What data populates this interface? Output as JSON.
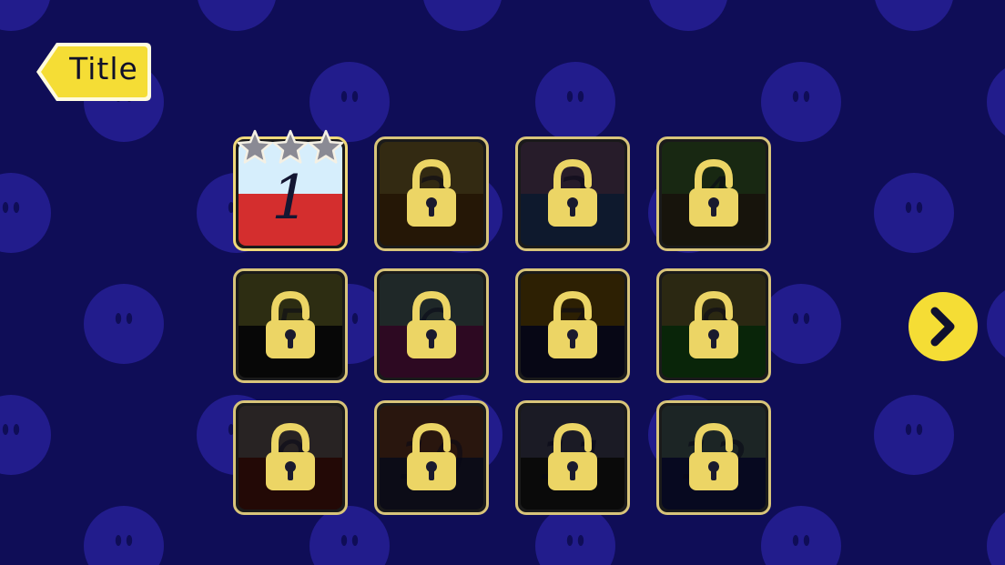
{
  "colors": {
    "background": "#0f0d57",
    "pattern_circle": "#221c8c",
    "accent_yellow": "#f5dd35",
    "tile_border": "#d8c47a",
    "lock_yellow": "#ecd565"
  },
  "header": {
    "title_button_label": "Title"
  },
  "levels": [
    {
      "number": "1",
      "locked": false,
      "stars_earned": 0,
      "stars_total": 3
    },
    {
      "number": "2",
      "locked": true,
      "top": "#423618",
      "bottom": "#301e08"
    },
    {
      "number": "3",
      "locked": true,
      "top": "#332436",
      "bottom": "#12203a"
    },
    {
      "number": "4",
      "locked": true,
      "top": "#1f3418",
      "bottom": "#1e1a10"
    },
    {
      "number": "5",
      "locked": true,
      "top": "#3a3a18",
      "bottom": "#090909"
    },
    {
      "number": "6",
      "locked": true,
      "top": "#283434",
      "bottom": "#3a0c2c"
    },
    {
      "number": "7",
      "locked": true,
      "top": "#3a2a05",
      "bottom": "#0a0a1c"
    },
    {
      "number": "8",
      "locked": true,
      "top": "#383418",
      "bottom": "#0c300c"
    },
    {
      "number": "9",
      "locked": true,
      "top": "#342d2d",
      "bottom": "#2e0c08"
    },
    {
      "number": "10",
      "locked": true,
      "top": "#351d12",
      "bottom": "#10101e"
    },
    {
      "number": "11",
      "locked": true,
      "top": "#232330",
      "bottom": "#0d0d0d"
    },
    {
      "number": "12",
      "locked": true,
      "top": "#253030",
      "bottom": "#0a0c2a"
    }
  ],
  "navigation": {
    "next_icon": "chevron-right-icon"
  }
}
